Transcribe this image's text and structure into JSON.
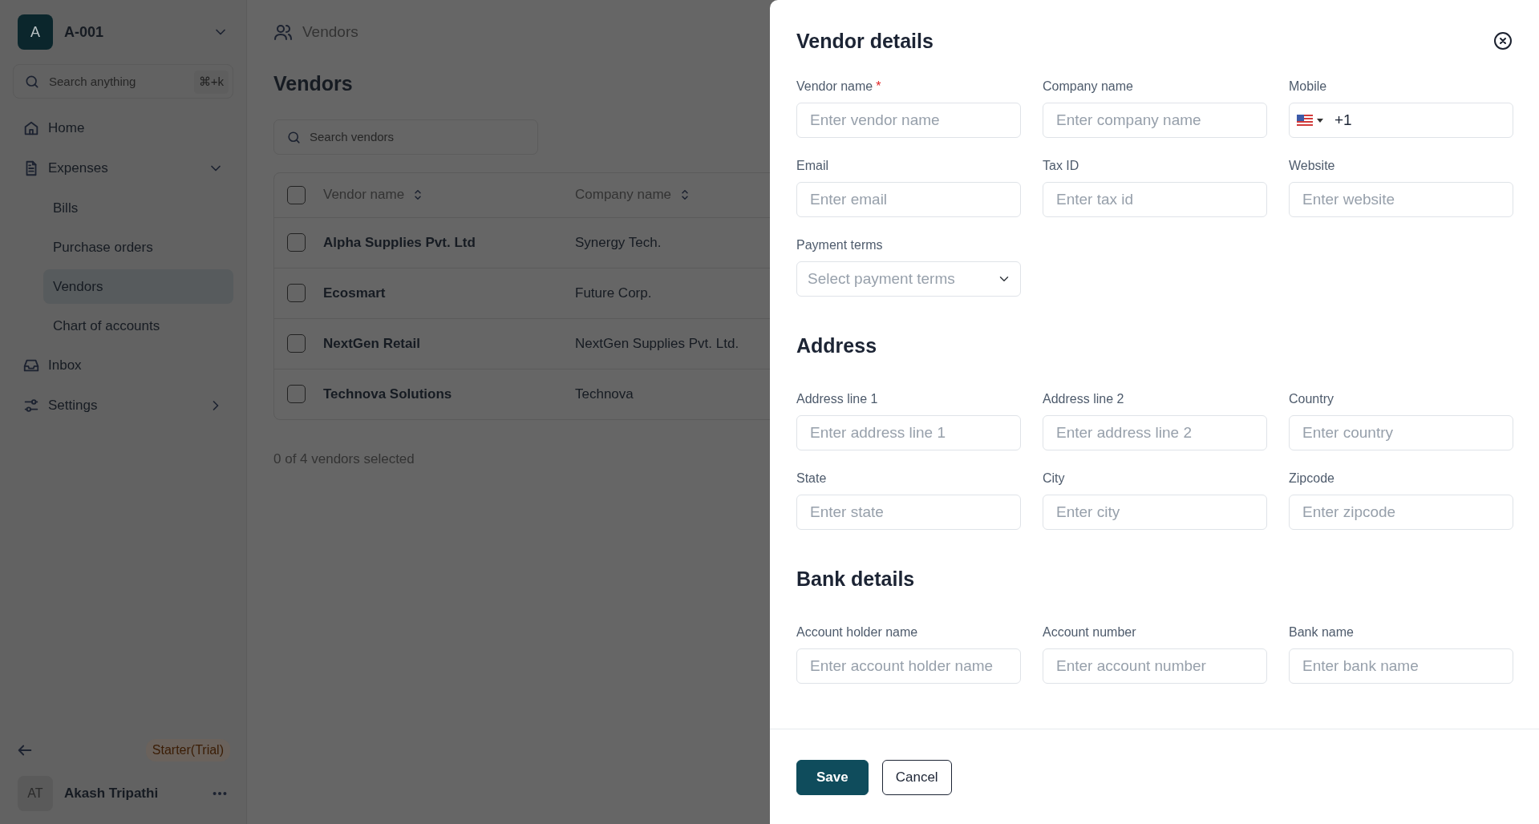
{
  "workspace": {
    "avatar": "A",
    "name": "A-001"
  },
  "sidebar": {
    "search": {
      "placeholder": "Search anything",
      "shortcut": "⌘+k"
    },
    "items": [
      {
        "label": "Home",
        "kind": "home"
      },
      {
        "label": "Expenses",
        "kind": "document",
        "expanded": true,
        "children": [
          {
            "label": "Bills",
            "selected": false
          },
          {
            "label": "Purchase orders",
            "selected": false
          },
          {
            "label": "Vendors",
            "selected": true
          },
          {
            "label": "Chart of accounts",
            "selected": false
          }
        ]
      },
      {
        "label": "Inbox",
        "kind": "inbox"
      },
      {
        "label": "Settings",
        "kind": "settings",
        "expanded": false
      }
    ],
    "plan_badge": "Starter(Trial)",
    "user": {
      "initials": "AT",
      "name": "Akash Tripathi"
    }
  },
  "main": {
    "breadcrumb": "Vendors",
    "title": "Vendors",
    "search": {
      "placeholder": "Search vendors"
    },
    "table": {
      "select_all_checked": false,
      "columns": [
        {
          "label": "Vendor name",
          "sortable": true
        },
        {
          "label": "Company name",
          "sortable": true
        }
      ],
      "rows": [
        {
          "checked": false,
          "cells": [
            "Alpha Supplies Pvt. Ltd",
            "Synergy Tech."
          ]
        },
        {
          "checked": false,
          "cells": [
            "Ecosmart",
            "Future Corp."
          ]
        },
        {
          "checked": false,
          "cells": [
            "NextGen Retail",
            "NextGen Supplies Pvt. Ltd."
          ]
        },
        {
          "checked": false,
          "cells": [
            "Technova Solutions",
            "Technova"
          ]
        }
      ]
    },
    "selection_summary": "0 of 4 vendors selected"
  },
  "drawer": {
    "title": "Vendor details",
    "sections": [
      {
        "fields": [
          {
            "label": "Vendor name",
            "required_mark": "*",
            "kind": "text",
            "placeholder": "Enter vendor name"
          },
          {
            "label": "Company name",
            "kind": "text",
            "placeholder": "Enter company name"
          },
          {
            "label": "Mobile",
            "kind": "phone",
            "value": "+1"
          },
          {
            "label": "Email",
            "kind": "text",
            "placeholder": "Enter email"
          },
          {
            "label": "Tax ID",
            "kind": "text",
            "placeholder": "Enter tax id"
          },
          {
            "label": "Website",
            "kind": "text",
            "placeholder": "Enter website"
          },
          {
            "label": "Payment terms",
            "kind": "select",
            "placeholder": "Select payment terms"
          }
        ]
      },
      {
        "heading": "Address",
        "fields": [
          {
            "label": "Address line 1",
            "kind": "text",
            "placeholder": "Enter address line 1"
          },
          {
            "label": "Address line 2",
            "kind": "text",
            "placeholder": "Enter address line 2"
          },
          {
            "label": "Country",
            "kind": "text",
            "placeholder": "Enter country"
          },
          {
            "label": "State",
            "kind": "text",
            "placeholder": "Enter state"
          },
          {
            "label": "City",
            "kind": "text",
            "placeholder": "Enter city"
          },
          {
            "label": "Zipcode",
            "kind": "text",
            "placeholder": "Enter zipcode"
          }
        ]
      },
      {
        "heading": "Bank details",
        "fields": [
          {
            "label": "Account holder name",
            "kind": "text",
            "placeholder": "Enter account holder name"
          },
          {
            "label": "Account number",
            "kind": "text",
            "placeholder": "Enter account number"
          },
          {
            "label": "Bank name",
            "kind": "text",
            "placeholder": "Enter bank name"
          }
        ]
      }
    ],
    "buttons": [
      {
        "label": "Save",
        "kind": "primary"
      },
      {
        "label": "Cancel",
        "kind": "secondary"
      }
    ]
  }
}
